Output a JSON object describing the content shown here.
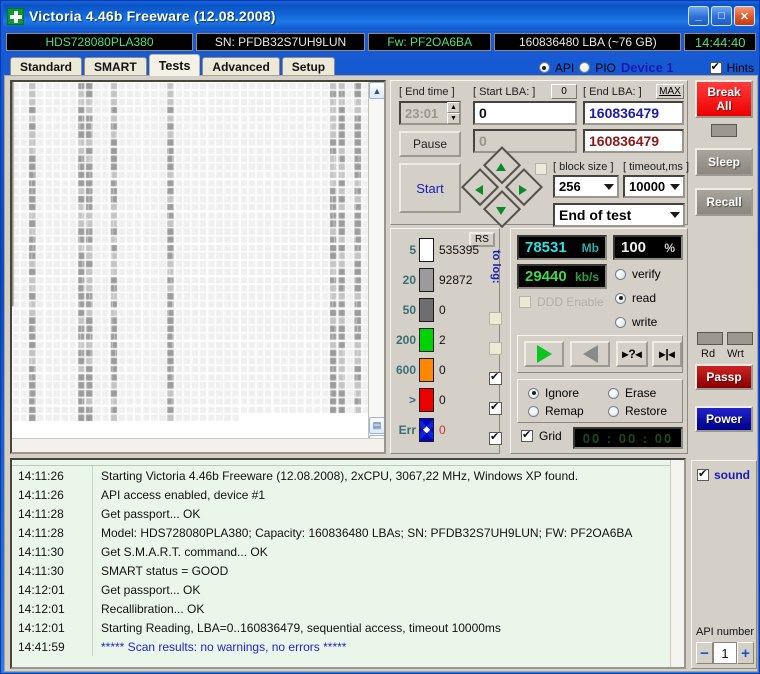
{
  "window": {
    "title": "Victoria 4.46b Freeware (12.08.2008)",
    "app_icon": "green-cross-icon",
    "minimize_label": "_",
    "maximize_label": "□",
    "close_label": "✕"
  },
  "infostrip": {
    "model": "HDS728080PLA380",
    "serial": "SN: PFDB32S7UH9LUN",
    "firmware": "Fw: PF2OA6BA",
    "capacity": "160836480 LBA (~76 GB)",
    "clock": "14:44:40"
  },
  "tabs": [
    {
      "label": "Standard",
      "active": false
    },
    {
      "label": "SMART",
      "active": false
    },
    {
      "label": "Tests",
      "active": true
    },
    {
      "label": "Advanced",
      "active": false
    },
    {
      "label": "Setup",
      "active": false
    }
  ],
  "interface_select": {
    "api_label": "API",
    "api_selected": true,
    "pio_label": "PIO",
    "pio_selected": false,
    "device_label": "Device 1",
    "hints_label": "Hints",
    "hints_checked": true
  },
  "controls": {
    "end_time_caption": "[ End time ]",
    "end_time_value": "23:01",
    "start_lba_caption": "[ Start LBA: ]",
    "start_lba_button": "0",
    "start_lba_value": "0",
    "start_lba_secondary": "0",
    "end_lba_caption": "[ End LBA: ]",
    "end_lba_button": "MAX",
    "end_lba_value": "160836479",
    "end_lba_secondary": "160836479",
    "pause_label": "Pause",
    "start_label": "Start",
    "block_size_caption": "[ block size ]",
    "block_size_value": "256",
    "timeout_caption": "[ timeout,ms ]",
    "timeout_value": "10000",
    "end_of_test_value": "End of test",
    "nav_pad": "direction-pad",
    "nav_checkbox_checked": false
  },
  "legend": {
    "rs_button": "RS",
    "to_log_label": "to log:",
    "rows": [
      {
        "threshold": "5",
        "color": "#ffffff",
        "count": "535395",
        "logged": false,
        "log_visible": false
      },
      {
        "threshold": "20",
        "color": "#9b9b9b",
        "count": "92872",
        "logged": false,
        "log_visible": false
      },
      {
        "threshold": "50",
        "color": "#6e6e6e",
        "count": "0",
        "logged": false,
        "log_visible": true
      },
      {
        "threshold": "200",
        "color": "#00d400",
        "count": "2",
        "logged": false,
        "log_visible": true
      },
      {
        "threshold": "600",
        "color": "#ff8800",
        "count": "0",
        "logged": true,
        "log_visible": true
      },
      {
        "threshold": ">",
        "color": "#ee0000",
        "count": "0",
        "logged": true,
        "log_visible": true
      },
      {
        "threshold": "Err",
        "color": "#1122dd",
        "count": "0",
        "logged": true,
        "log_visible": true
      }
    ]
  },
  "stats": {
    "size_value": "78531",
    "size_unit": "Mb",
    "percent_value": "100",
    "percent_unit": "%",
    "speed_value": "29440",
    "speed_unit": "kb/s",
    "ddd_enable_label": "DDD Enable",
    "ddd_enabled": false,
    "modes": [
      {
        "label": "verify",
        "selected": false
      },
      {
        "label": "read",
        "selected": true
      },
      {
        "label": "write",
        "selected": false
      }
    ],
    "transport": [
      {
        "name": "play-forward-button",
        "glyph": "▶"
      },
      {
        "name": "play-backward-button",
        "glyph": "◀"
      },
      {
        "name": "random-seek-button",
        "glyph": "?"
      },
      {
        "name": "seek-end-button",
        "glyph": "▶|"
      }
    ],
    "actions": [
      {
        "label": "Ignore",
        "selected": true
      },
      {
        "label": "Erase",
        "selected": false
      },
      {
        "label": "Remap",
        "selected": false
      },
      {
        "label": "Restore",
        "selected": false
      }
    ],
    "grid_label": "Grid",
    "grid_checked": true,
    "grid_timer": "00 : 00 : 00"
  },
  "right_buttons": {
    "break_all": "Break\nAll",
    "break_all_line1": "Break",
    "break_all_line2": "All",
    "sleep": "Sleep",
    "recall": "Recall",
    "rd_label": "Rd",
    "wrt_label": "Wrt",
    "passp": "Passp",
    "power": "Power"
  },
  "log": {
    "entries": [
      {
        "time": "14:11:26",
        "message": "Starting Victoria 4.46b Freeware (12.08.2008), 2xCPU, 3067,22 MHz, Windows XP found.",
        "highlight": false
      },
      {
        "time": "14:11:26",
        "message": "API access enabled, device #1",
        "highlight": false
      },
      {
        "time": "14:11:28",
        "message": "Get passport... OK",
        "highlight": false
      },
      {
        "time": "14:11:28",
        "message": "Model: HDS728080PLA380; Capacity: 160836480 LBAs; SN: PFDB32S7UH9LUN; FW: PF2OA6BA",
        "highlight": false
      },
      {
        "time": "14:11:30",
        "message": "Get S.M.A.R.T. command... OK",
        "highlight": false
      },
      {
        "time": "14:11:30",
        "message": "SMART status = GOOD",
        "highlight": false
      },
      {
        "time": "14:12:01",
        "message": "Get passport... OK",
        "highlight": false
      },
      {
        "time": "14:12:01",
        "message": "Recallibration... OK",
        "highlight": false
      },
      {
        "time": "14:12:01",
        "message": "Starting Reading, LBA=0..160836479, sequential access, timeout 10000ms",
        "highlight": false
      },
      {
        "time": "14:41:59",
        "message": "***** Scan results: no warnings, no errors *****",
        "highlight": true
      }
    ]
  },
  "bottom_right": {
    "sound_label": "sound",
    "sound_checked": true,
    "api_number_label": "API number",
    "api_number_value": "1",
    "minus_label": "−",
    "plus_label": "+"
  },
  "colors": {
    "titlebar": "#0f5fd2",
    "window_face": "#d4d0c8",
    "lcd_bg": "#000000",
    "lcd_green": "#4fe07a",
    "lcd_cyan": "#2fe0e0",
    "accent_blue": "#1a1ab0",
    "break_red": "#ff0000",
    "passp_red": "#bb0000",
    "power_blue": "#0000cc",
    "log_bg": "#eaf6ea",
    "log_blue": "#2222cc"
  }
}
